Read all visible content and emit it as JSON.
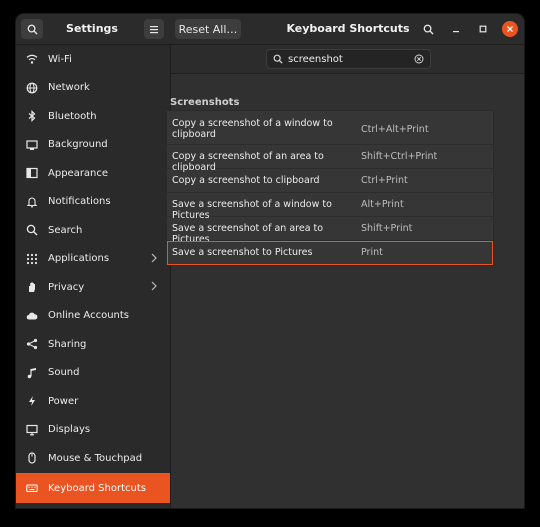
{
  "titlebar": {
    "settings_title": "Settings",
    "reset_label": "Reset All…",
    "page_title": "Keyboard Shortcuts"
  },
  "sidebar": {
    "items": [
      {
        "label": "Wi-Fi",
        "icon": "wifi-icon"
      },
      {
        "label": "Network",
        "icon": "network-icon"
      },
      {
        "label": "Bluetooth",
        "icon": "bluetooth-icon"
      },
      {
        "label": "Background",
        "icon": "background-icon"
      },
      {
        "label": "Appearance",
        "icon": "appearance-icon"
      },
      {
        "label": "Notifications",
        "icon": "bell-icon"
      },
      {
        "label": "Search",
        "icon": "search-icon"
      },
      {
        "label": "Applications",
        "icon": "applications-icon"
      },
      {
        "label": "Privacy",
        "icon": "hand-icon"
      },
      {
        "label": "Online Accounts",
        "icon": "cloud-icon"
      },
      {
        "label": "Sharing",
        "icon": "share-icon"
      },
      {
        "label": "Sound",
        "icon": "music-note-icon"
      },
      {
        "label": "Power",
        "icon": "power-icon"
      },
      {
        "label": "Displays",
        "icon": "display-icon"
      },
      {
        "label": "Mouse & Touchpad",
        "icon": "mouse-icon"
      },
      {
        "label": "Keyboard Shortcuts",
        "icon": "keyboard-icon"
      }
    ]
  },
  "search": {
    "value": "screenshot"
  },
  "shortcuts": {
    "group_title": "Screenshots",
    "rows": [
      {
        "name": "Copy a screenshot of a window to clipboard",
        "accel": "Ctrl+Alt+Print"
      },
      {
        "name": "Copy a screenshot of an area to clipboard",
        "accel": "Shift+Ctrl+Print"
      },
      {
        "name": "Copy a screenshot to clipboard",
        "accel": "Ctrl+Print"
      },
      {
        "name": "Save a screenshot of a window to Pictures",
        "accel": "Alt+Print"
      },
      {
        "name": "Save a screenshot of an area to Pictures",
        "accel": "Shift+Print"
      },
      {
        "name": "Save a screenshot to Pictures",
        "accel": "Print"
      }
    ]
  },
  "colors": {
    "accent": "#e95420"
  }
}
